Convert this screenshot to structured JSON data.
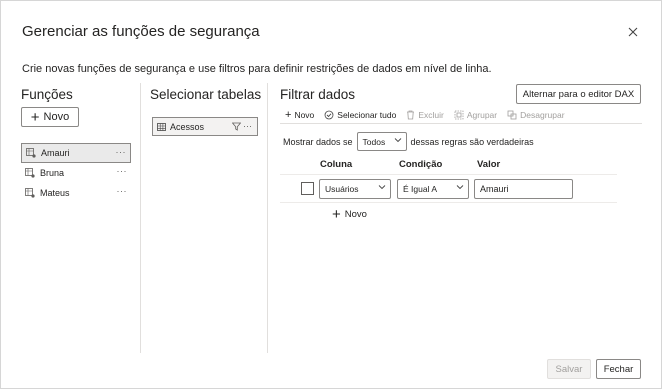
{
  "dialog": {
    "title": "Gerenciar as funções de segurança",
    "subtitle": "Crie novas funções de segurança e use filtros para definir restrições de dados em nível de linha."
  },
  "roles": {
    "header": "Funções",
    "new_label": "Novo",
    "items": [
      {
        "label": "Amauri",
        "selected": true
      },
      {
        "label": "Bruna",
        "selected": false
      },
      {
        "label": "Mateus",
        "selected": false
      }
    ],
    "more_label": "···"
  },
  "tables": {
    "header": "Selecionar tabelas",
    "items": [
      {
        "label": "Acessos"
      }
    ]
  },
  "filter": {
    "header": "Filtrar dados",
    "dax_button": "Alternar para o editor DAX",
    "toolbar": {
      "new": "Novo",
      "select_all": "Selecionar tudo",
      "delete": "Excluir",
      "group": "Agrupar",
      "ungroup": "Desagrupar"
    },
    "show_prefix": "Mostrar dados se",
    "show_mode": "Todos",
    "show_suffix": "dessas regras são verdadeiras",
    "columns": {
      "column": "Coluna",
      "condition": "Condição",
      "value": "Valor"
    },
    "rule": {
      "column": "Usuários",
      "condition": "É Igual A",
      "value": "Amauri"
    },
    "new_rule_label": "Novo"
  },
  "footer": {
    "save": "Salvar",
    "close": "Fechar"
  },
  "colors": {
    "accent": "#252423",
    "border": "#8a8886",
    "disabled": "#a19f9d"
  }
}
